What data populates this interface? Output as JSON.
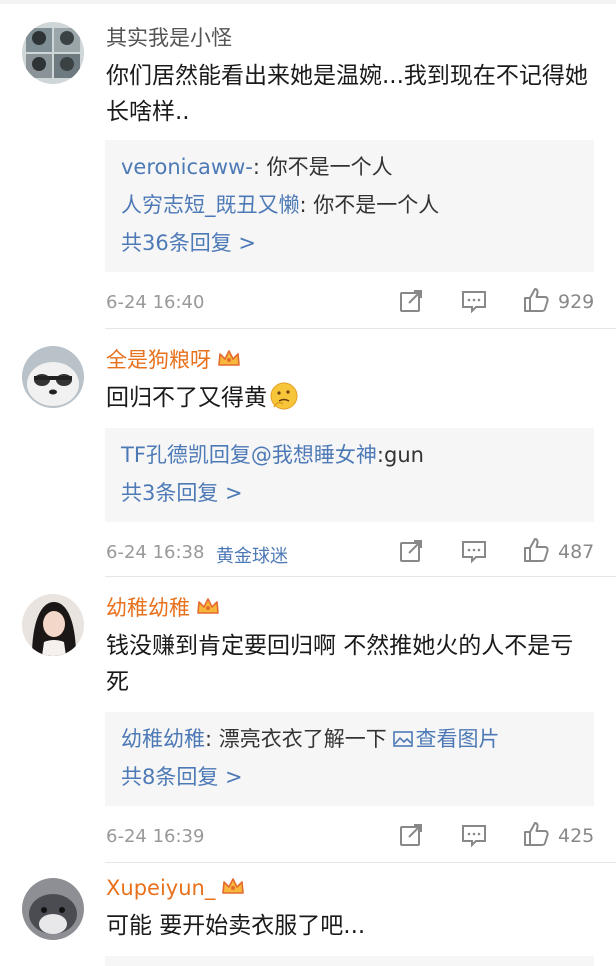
{
  "comments": [
    {
      "username": "其实我是小怪",
      "has_crown": false,
      "text": "你们居然能看出来她是温婉...我到现在不记得她长啥样..",
      "replies": [
        {
          "author": "veronicaww-",
          "sep": ": ",
          "text": "你不是一个人"
        },
        {
          "author": "人穷志短_既丑又懒",
          "sep": ": ",
          "text": "你不是一个人"
        }
      ],
      "more_replies": "共36条回复 >",
      "time": "6-24 16:40",
      "tag": "",
      "likes": "929"
    },
    {
      "username": "全是狗粮呀",
      "has_crown": true,
      "text": "回归不了又得黄",
      "emoji": "thinking-emoji",
      "replies": [
        {
          "author": "TF孔德凯回复@我想睡女神",
          "sep": ":",
          "text": "gun"
        }
      ],
      "more_replies": "共3条回复 >",
      "time": "6-24 16:38",
      "tag": "黄金球迷",
      "likes": "487"
    },
    {
      "username": "幼稚幼稚",
      "has_crown": true,
      "text": "钱没赚到肯定要回归啊  不然推她火的人不是亏死",
      "replies": [
        {
          "author": "幼稚幼稚",
          "sep": ": ",
          "text": "漂亮衣衣了解一下 ",
          "link": "查看图片"
        }
      ],
      "more_replies": "共8条回复 >",
      "time": "6-24 16:39",
      "tag": "",
      "likes": "425"
    },
    {
      "username": "Xupeiyun_",
      "has_crown": true,
      "text": "可能  要开始卖衣服了吧..."
    }
  ],
  "colors": {
    "name_orange": "#e8711d",
    "link_blue": "#4d7ab6",
    "reply_bg": "#f6f6f6",
    "meta_gray": "#999999"
  },
  "icons": [
    "share-icon",
    "comment-icon",
    "like-icon",
    "crown-icon",
    "image-icon"
  ]
}
